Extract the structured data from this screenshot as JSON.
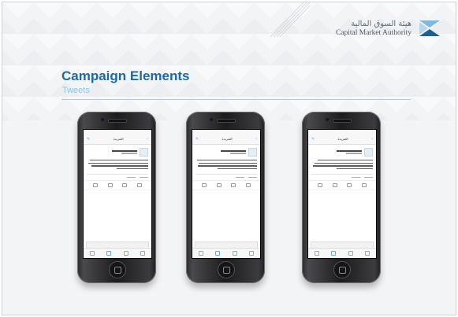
{
  "header": {
    "logo_arabic": "هيئة السوق المالية",
    "logo_english": "Capital Market Authority"
  },
  "title": "Campaign Elements",
  "subtitle": "Tweets",
  "colors": {
    "accent": "#1a6aa8",
    "subtitle": "#8cc4e6",
    "twitter_blue": "#55acee"
  },
  "phones": [
    {
      "nav_title": "التغريدة"
    },
    {
      "nav_title": "التغريدة"
    },
    {
      "nav_title": "التغريدة"
    }
  ]
}
